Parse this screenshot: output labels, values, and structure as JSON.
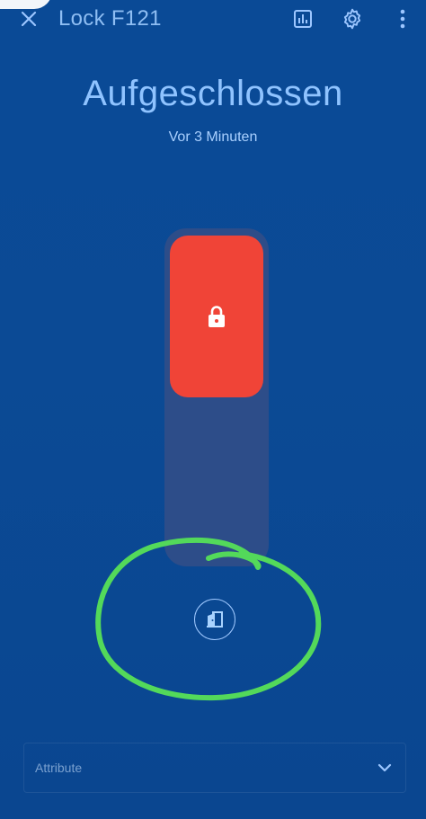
{
  "header": {
    "title": "Lock F121",
    "icons": [
      "close-icon",
      "history-icon",
      "settings-gear-icon",
      "more-vertical-icon"
    ]
  },
  "status": {
    "state": "Aufgeschlossen",
    "time_ago": "Vor 3 Minuten"
  },
  "control": {
    "knob_icon": "lock-icon",
    "knob_color": "#f04437",
    "track_color": "#2d4d89",
    "action_icon": "door-open-icon"
  },
  "attributes": {
    "label": "Attribute"
  },
  "colors": {
    "background": "#0a4a96",
    "accent_text": "#8fc3ff",
    "annotation": "#53d95a"
  }
}
